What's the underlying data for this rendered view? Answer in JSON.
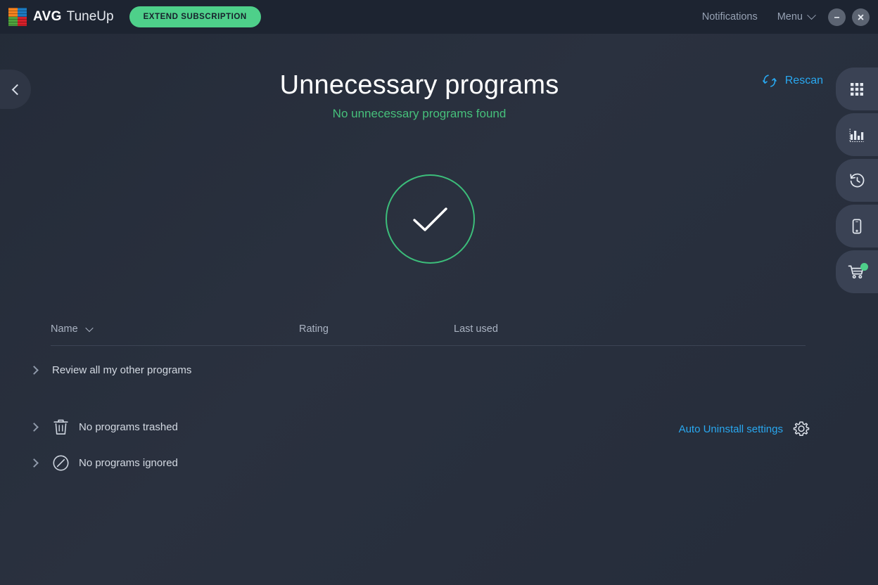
{
  "window": {
    "brand_avg": "AVG",
    "brand_product": "TuneUp",
    "extend_button": "EXTEND SUBSCRIPTION",
    "notifications": "Notifications",
    "menu": "Menu",
    "minimize_icon": "minimize-icon",
    "close_icon": "close-icon",
    "logo_icon": "avg-logo-icon",
    "menu_caret_icon": "chevron-down-icon"
  },
  "navigation": {
    "back_icon": "chevron-left-icon",
    "rail": [
      {
        "icon": "grid-apps-icon",
        "name": "all-features"
      },
      {
        "icon": "bar-chart-icon",
        "name": "performance-report"
      },
      {
        "icon": "history-clock-icon",
        "name": "history"
      },
      {
        "icon": "mobile-phone-icon",
        "name": "mobile"
      },
      {
        "icon": "shopping-cart-icon",
        "name": "store",
        "badge": true
      }
    ]
  },
  "main": {
    "title": "Unnecessary programs",
    "subtitle": "No unnecessary programs found",
    "rescan_label": "Rescan",
    "rescan_icon": "refresh-icon",
    "status_icon": "check-circle-icon"
  },
  "table": {
    "columns": {
      "name": "Name",
      "rating": "Rating",
      "last_used": "Last used"
    },
    "sort_icon": "chevron-down-icon",
    "rows": []
  },
  "sections": [
    {
      "label": "Review all my other programs",
      "chevron_icon": "chevron-right-icon",
      "icon": null
    },
    {
      "label": "No programs trashed",
      "chevron_icon": "chevron-right-icon",
      "icon": "trash-icon"
    },
    {
      "label": "No programs ignored",
      "chevron_icon": "chevron-right-icon",
      "icon": "ignore-circle-slash-icon"
    }
  ],
  "auto_uninstall": {
    "label": "Auto Uninstall settings",
    "icon": "gear-icon"
  },
  "colors": {
    "accent_green": "#4ed08a",
    "accent_blue": "#29a8f0",
    "status_green": "#3cbd7a",
    "titlebar": "#1d2431",
    "background": "#262d3b"
  }
}
